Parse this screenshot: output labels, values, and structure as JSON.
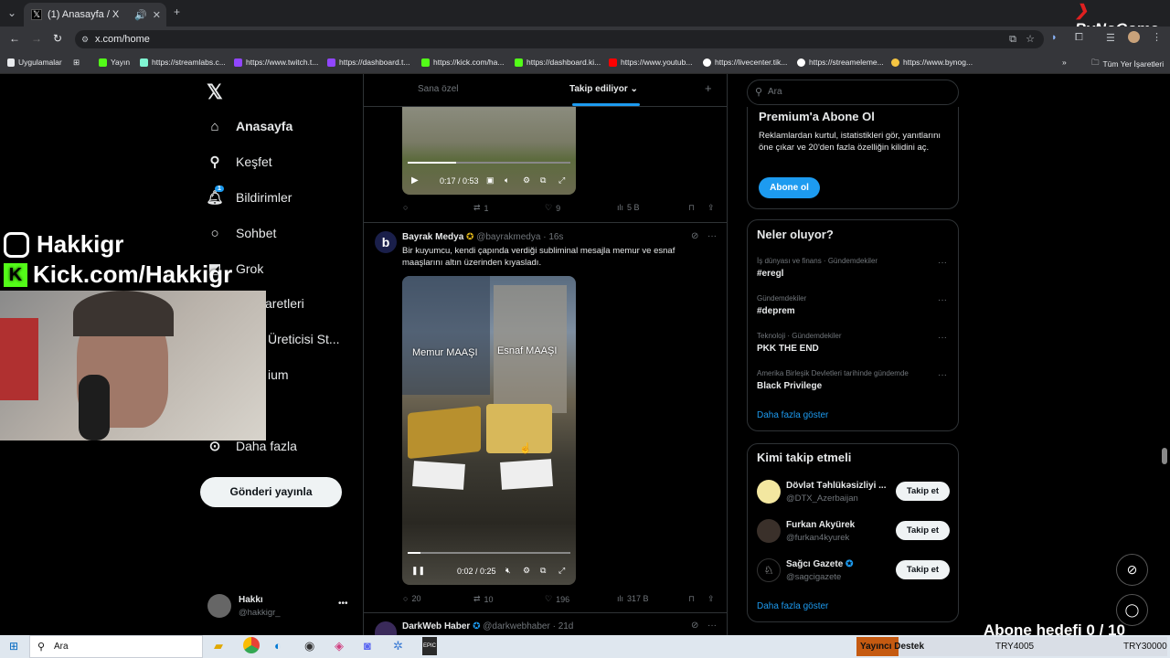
{
  "browser": {
    "tab_title": "(1) Anasayfa / X",
    "url": "x.com/home",
    "bookmarks": [
      {
        "label": "Uygulamalar",
        "color": "#e8eaed"
      },
      {
        "label": "Yayın",
        "color": "#53fc18"
      },
      {
        "label": "https://streamlabs.c...",
        "color": "#80f5d2"
      },
      {
        "label": "https://www.twitch.t...",
        "color": "#9146ff"
      },
      {
        "label": "https://dashboard.t...",
        "color": "#9146ff"
      },
      {
        "label": "https://kick.com/ha...",
        "color": "#53fc18"
      },
      {
        "label": "https://dashboard.ki...",
        "color": "#53fc18"
      },
      {
        "label": "https://www.youtub...",
        "color": "#ff0000"
      },
      {
        "label": "https://livecenter.tik...",
        "color": "#ffffff"
      },
      {
        "label": "https://streameleme...",
        "color": "#ffffff"
      },
      {
        "label": "https://www.bynog...",
        "color": "#f5c542"
      }
    ],
    "all_bookmarks": "Tüm Yer İşaretleri"
  },
  "overlay": {
    "bynogame": "ByNoGame",
    "instagram": "Hakkigr",
    "kick": "Kick.com/Hakkigr",
    "goal": "Abone hedefi 0 / 10"
  },
  "nav": {
    "home": "Anasayfa",
    "explore": "Keşfet",
    "notifications": "Bildirimler",
    "notif_count": "1",
    "messages": "Sohbet",
    "grok": "Grok",
    "bookmarks": "aretleri",
    "creator": "Üreticisi St...",
    "premium": "ium",
    "more": "Daha fazla",
    "post": "Gönderi yayınla",
    "profile_name": "Hakkı",
    "profile_handle": "@hakkigr_"
  },
  "feed": {
    "tab_for_you": "Sana özel",
    "tab_following": "Takip ediliyor",
    "tweet0": {
      "video_time": "0:17 / 0:53",
      "replies": "",
      "retweets": "1",
      "likes": "9",
      "views": "5 B"
    },
    "tweet1": {
      "name": "Bayrak Medya",
      "handle": "@bayrakmedya",
      "time": "16s",
      "text": "Bir kuyumcu, kendi çapında verdiği subliminal mesajla memur ve esnaf maaşlarını altın üzerinden kıyasladı.",
      "overlay_left": "Memur MAAŞI",
      "overlay_right": "Esnaf MAAŞI",
      "video_time": "0:02 / 0:25",
      "replies": "20",
      "retweets": "10",
      "likes": "196",
      "views": "317 B"
    },
    "tweet2": {
      "name": "DarkWeb Haber",
      "handle": "@darkwebhaber",
      "time": "21d"
    }
  },
  "right": {
    "search_placeholder": "Ara",
    "premium_title": "Premium'a Abone Ol",
    "premium_text": "Reklamlardan kurtul, istatistikleri gör, yanıtlarını öne çıkar ve 20'den fazla özelliğin kilidini aç.",
    "premium_button": "Abone ol",
    "trends_title": "Neler oluyor?",
    "trends": [
      {
        "context": "İş dünyası ve finans · Gündemdekiler",
        "name": "#eregl"
      },
      {
        "context": "Gündemdekiler",
        "name": "#deprem"
      },
      {
        "context": "Teknoloji · Gündemdekiler",
        "name": "PKK THE END"
      },
      {
        "context": "Amerika Birleşik Devletleri tarihinde gündemde",
        "name": "Black Privilege"
      }
    ],
    "show_more": "Daha fazla göster",
    "who_title": "Kimi takip etmeli",
    "who": [
      {
        "name": "Dövlət Təhlükəsizliyi ...",
        "handle": "@DTX_Azerbaijan",
        "button": "Takip et"
      },
      {
        "name": "Furkan Akyürek",
        "handle": "@furkan4kyurek",
        "button": "Takip et"
      },
      {
        "name": "Sağcı Gazete",
        "handle": "@sagcigazete",
        "button": "Takip et"
      }
    ]
  },
  "taskbar": {
    "search": "Ara",
    "donation_label": "Yayıncı Destek",
    "amount1": "TRY4005",
    "amount2": "TRY30000"
  }
}
